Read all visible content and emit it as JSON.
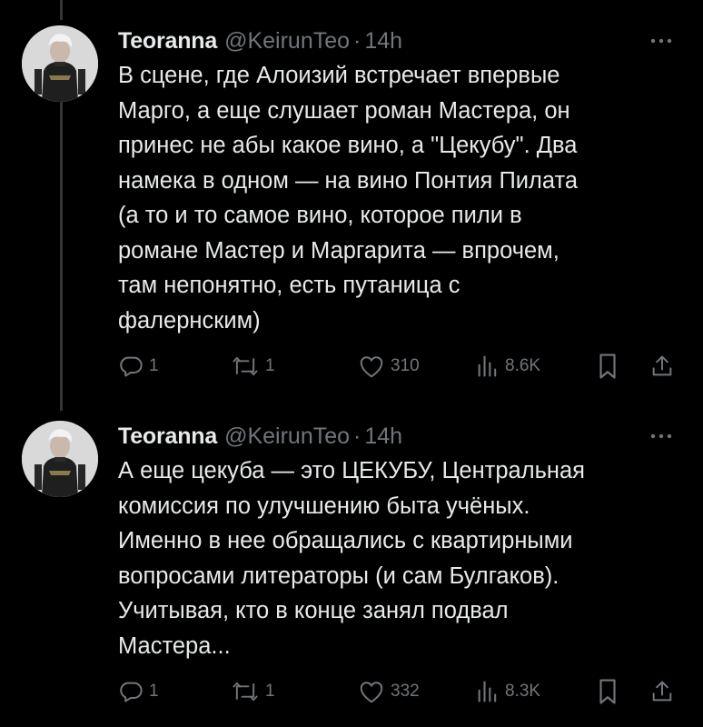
{
  "tweets": [
    {
      "author": {
        "display_name": "Teoranna",
        "handle": "@KeirunTeo",
        "separator": "·",
        "time": "14h"
      },
      "text": "В сцене, где Алоизий встречает впервые\nМарго, а еще слушает роман Мастера, он\nпринес не абы какое вино, а \"Цекубу\". Два\nнамека в одном — на вино Понтия Пилата\n(а то и то самое вино, которое пили в\nромане Мастер и Маргарита — впрочем,\nтам непонятно, есть путаница с\nфалернским)",
      "stats": {
        "replies": "1",
        "retweets": "1",
        "likes": "310",
        "views": "8.6K"
      }
    },
    {
      "author": {
        "display_name": "Teoranna",
        "handle": "@KeirunTeo",
        "separator": "·",
        "time": "14h"
      },
      "text": "А еще цекуба — это ЦЕКУБУ, Центральная\nкомиссия по улучшению быта учёных.\nИменно в нее обращались с квартирными\nвопросами литераторы (и сам Булгаков).\nУчитывая, кто в конце занял подвал\nМастера...",
      "stats": {
        "replies": "1",
        "retweets": "1",
        "likes": "332",
        "views": "8.3K"
      }
    }
  ],
  "icons": {
    "more": "more-horizontal-icon",
    "reply": "reply-bubble-icon",
    "retweet": "retweet-arrows-icon",
    "like": "heart-icon",
    "views": "bar-chart-icon",
    "bookmark": "bookmark-icon",
    "share": "share-upload-icon"
  },
  "colors": {
    "background": "#000000",
    "text": "#e7e9ea",
    "secondary": "#71767b",
    "thread_line": "#333639"
  }
}
